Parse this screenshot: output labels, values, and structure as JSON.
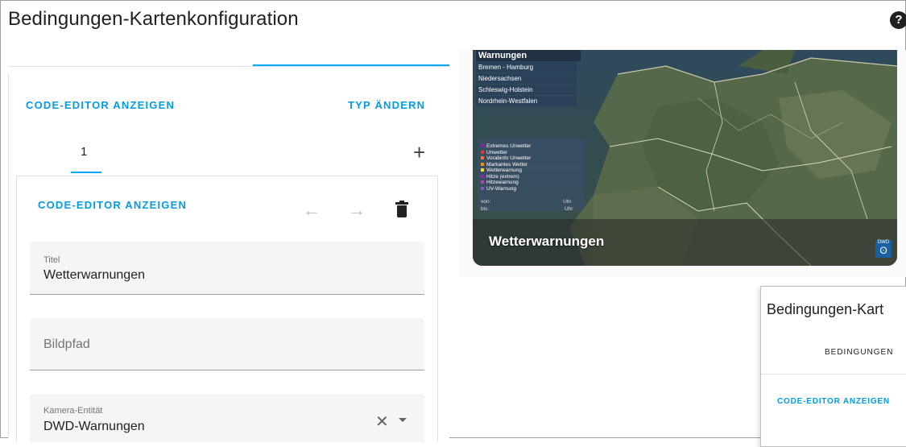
{
  "dialog": {
    "title": "Bedingungen-Kartenkonfiguration",
    "help_icon": "help-circle-icon"
  },
  "editor": {
    "show_code_editor": "CODE-EDITOR ANZEIGEN",
    "change_type": "TYP ÄNDERN",
    "tabs": [
      {
        "label": "1"
      }
    ],
    "add_icon": "plus-icon"
  },
  "card_editor": {
    "show_code_editor": "CODE-EDITOR ANZEIGEN",
    "icons": [
      "arrow-left-icon",
      "arrow-right-icon",
      "delete-icon"
    ],
    "fields": {
      "title": {
        "label": "Titel",
        "value": "Wetterwarnungen"
      },
      "image_path": {
        "placeholder": "Bildpfad"
      },
      "camera_entity": {
        "label": "Kamera-Entität",
        "value": "DWD-Warnungen"
      }
    }
  },
  "preview": {
    "card_title": "Wetterwarnungen",
    "map_header": "Warnungen",
    "regions": [
      "Bremen - Hamburg",
      "Niedersachsen",
      "Schleswig-Holstein",
      "Nordrhein-Westfalen"
    ],
    "legend": [
      {
        "label": "Extremes Unwetter",
        "color": "#8e24aa"
      },
      {
        "label": "Unwetter",
        "color": "#e53935"
      },
      {
        "label": "Vorabinfo Unwetter",
        "color": "#ff7043"
      },
      {
        "label": "Markantes Wetter",
        "color": "#fb8c00"
      },
      {
        "label": "Wetterwarnung",
        "color": "#fdd835"
      },
      {
        "label": "Hitze (extrem)",
        "color": "#9c27b0"
      },
      {
        "label": "Hitzewarnung",
        "color": "#ab47bc"
      },
      {
        "label": "UV-Warnung",
        "color": "#7e57c2"
      }
    ],
    "legend_von": "von:",
    "legend_bis": "bis:",
    "legend_uhr": "Uhr",
    "logo_text": "DWD"
  },
  "nested_dialog": {
    "title": "Bedingungen-Kart",
    "tab": "BEDINGUNGEN",
    "link": "CODE-EDITOR ANZEIGEN"
  },
  "colors": {
    "accent": "#03a9f4",
    "link": "#039be5",
    "field_bg": "#f5f5f5"
  }
}
